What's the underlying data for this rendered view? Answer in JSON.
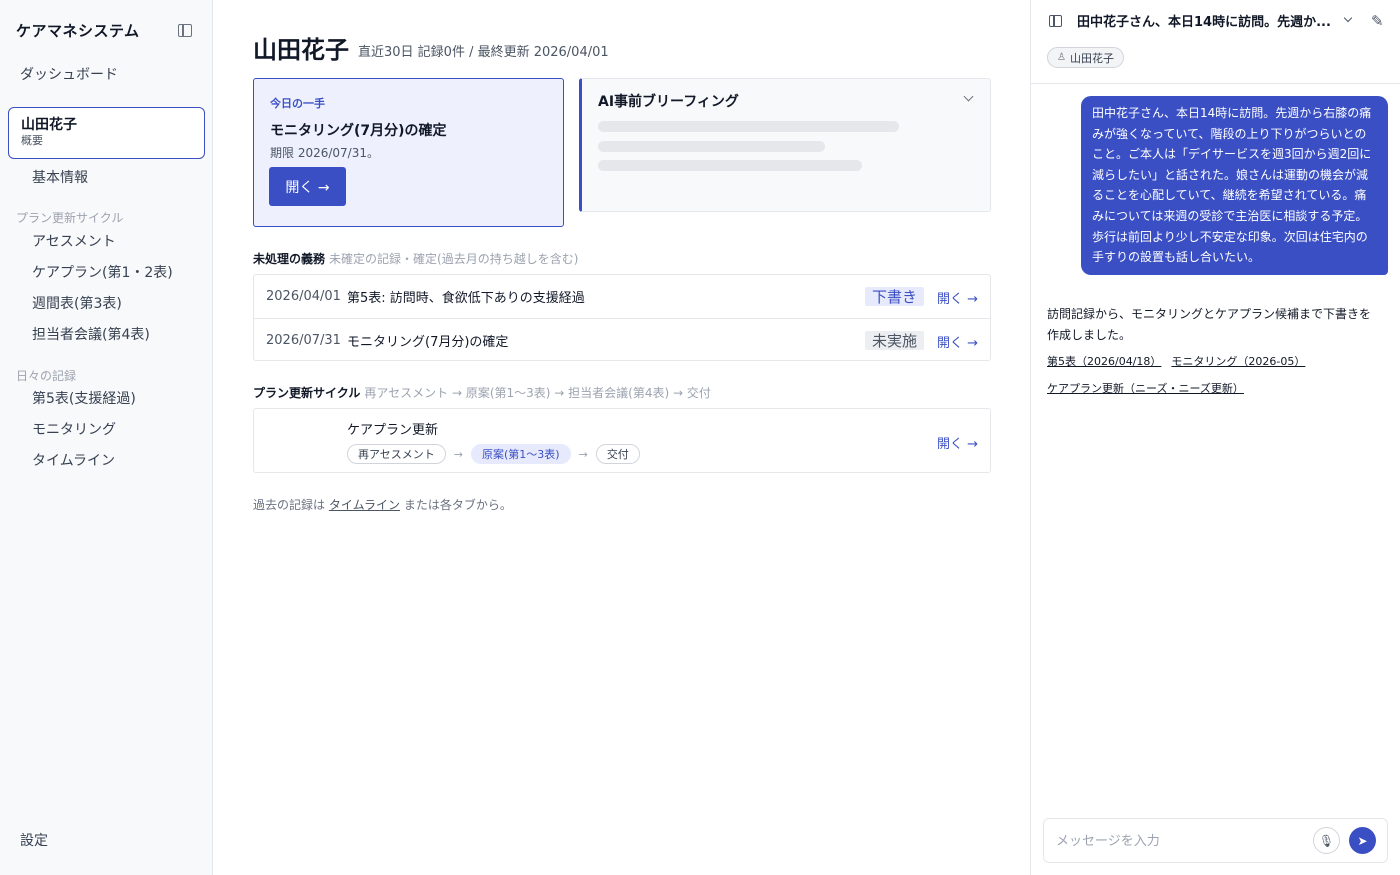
{
  "sidebar": {
    "app_title": "ケアマネシステム",
    "dashboard": "ダッシュボード",
    "patient_name": "山田花子",
    "patient_sub": "概要",
    "basic_info": "基本情報",
    "section_plan": "プラン更新サイクル",
    "plan_items": [
      "アセスメント",
      "ケアプラン(第1・2表)",
      "週間表(第3表)",
      "担当者会議(第4表)"
    ],
    "section_daily": "日々の記録",
    "daily_items": [
      "第5表(支援経過)",
      "モニタリング",
      "タイムライン"
    ],
    "settings": "設定"
  },
  "main": {
    "title": "山田花子",
    "meta": "直近30日 記録0件 / 最終更新 2026/04/01",
    "today": {
      "label": "今日の一手",
      "title": "モニタリング(7月分)の確定",
      "deadline": "期限 2026/07/31。",
      "button": "開く →"
    },
    "ai_briefing": {
      "title": "AI事前ブリーフィング"
    },
    "duties": {
      "label": "未処理の義務",
      "hint": "未確定の記録・確定(過去月の持ち越しを含む)",
      "rows": [
        {
          "date": "2026/04/01",
          "text": "第5表: 訪問時、食欲低下ありの支援経過",
          "badge": "下書き",
          "link": "開く →"
        },
        {
          "date": "2026/07/31",
          "text": "モニタリング(7月分)の確定",
          "badge": "未実施",
          "link": "開く →"
        }
      ]
    },
    "cycle": {
      "label": "プラン更新サイクル",
      "hint": "再アセスメント → 原案(第1〜3表) → 担当者会議(第4表) → 交付",
      "title": "ケアプラン更新",
      "steps": [
        "再アセスメント",
        "原案(第1〜3表)",
        "交付"
      ],
      "arrow": "→",
      "link": "開く →"
    },
    "footer": {
      "prefix": "過去の記録は",
      "link": "タイムライン",
      "suffix": "または各タブから。"
    }
  },
  "chat": {
    "title": "田中花子さん、本日14時に訪問。先週か...",
    "chip": "山田花子",
    "user_message": "田中花子さん、本日14時に訪問。先週から右膝の痛みが強くなっていて、階段の上り下りがつらいとのこと。ご本人は「デイサービスを週3回から週2回に減らしたい」と話された。娘さんは運動の機会が減ることを心配していて、継続を希望されている。痛みについては来週の受診で主治医に相談する予定。歩行は前回より少し不安定な印象。次回は住宅内の手すりの設置も話し合いたい。",
    "ai_message": "訪問記録から、モニタリングとケアプラン候補まで下書きを作成しました。",
    "links": [
      "第5表（2026/04/18）",
      "モニタリング（2026-05）",
      "ケアプラン更新（ニーズ・ニーズ更新）"
    ],
    "input_placeholder": "メッセージを入力"
  },
  "colors": {
    "accent": "#3b4fc4",
    "accent_light": "#eef1fd",
    "border": "#e5e7eb"
  }
}
